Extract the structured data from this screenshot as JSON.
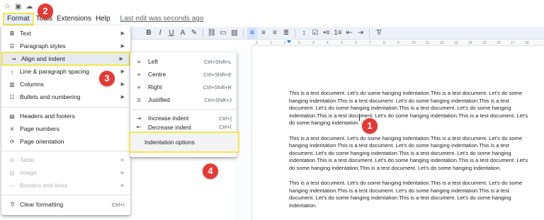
{
  "menubar": {
    "format": "Format",
    "tools": "Tools",
    "extensions": "Extensions",
    "help": "Help",
    "last_edit": "Last edit was seconds ago"
  },
  "format_menu": {
    "items": [
      {
        "label": "Text",
        "icon": "bold-icon",
        "submenu": true,
        "disabled": false
      },
      {
        "label": "Paragraph styles",
        "icon": "paragraph-styles-icon",
        "submenu": true,
        "disabled": false
      },
      {
        "label": "Align and indent",
        "icon": "align-indent-icon",
        "submenu": true,
        "disabled": false,
        "highlighted": true
      },
      {
        "label": "Line & paragraph spacing",
        "icon": "line-spacing-icon",
        "submenu": true,
        "disabled": false
      },
      {
        "label": "Columns",
        "icon": "columns-icon",
        "submenu": true,
        "disabled": false
      },
      {
        "label": "Bullets and numbering",
        "icon": "bullets-icon",
        "submenu": true,
        "disabled": false
      },
      {
        "label": "Headers and footers",
        "icon": "headers-footers-icon",
        "submenu": false,
        "disabled": false
      },
      {
        "label": "Page numbers",
        "icon": "page-numbers-icon",
        "submenu": false,
        "disabled": false
      },
      {
        "label": "Page orientation",
        "icon": "page-orientation-icon",
        "submenu": false,
        "disabled": false
      },
      {
        "label": "Table",
        "icon": "table-icon",
        "submenu": true,
        "disabled": true
      },
      {
        "label": "Image",
        "icon": "image-icon",
        "submenu": true,
        "disabled": true
      },
      {
        "label": "Borders and lines",
        "icon": "borders-lines-icon",
        "submenu": true,
        "disabled": true
      },
      {
        "label": "Clear formatting",
        "icon": "clear-formatting-icon",
        "shortcut": "Ctrl+\\",
        "disabled": false
      }
    ]
  },
  "align_submenu": {
    "items": [
      {
        "label": "Left",
        "shortcut": "Ctrl+Shift+L",
        "icon": "align-left-icon"
      },
      {
        "label": "Centre",
        "shortcut": "Ctrl+Shift+E",
        "icon": "align-center-icon"
      },
      {
        "label": "Right",
        "shortcut": "Ctrl+Shift+R",
        "icon": "align-right-icon"
      },
      {
        "label": "Justified",
        "shortcut": "Ctrl+Shift+J",
        "icon": "align-justify-icon"
      },
      {
        "label": "Increase indent",
        "shortcut": "Ctrl+]",
        "icon": "increase-indent-icon"
      },
      {
        "label": "Decrease indent",
        "shortcut": "Ctrl+[",
        "icon": "decrease-indent-icon"
      },
      {
        "label": "Indentation options",
        "highlighted": true
      }
    ]
  },
  "ruler": {
    "marks": [
      "2",
      "1",
      "1",
      "2",
      "3",
      "4",
      "5",
      "6",
      "7",
      "8",
      "9",
      "10",
      "11",
      "12",
      "13",
      "14",
      "15",
      "16",
      "17",
      "18"
    ]
  },
  "document": {
    "paragraph_1": "This is a test document. Let's do some hanging indentation.This is a test document. Let's do some hanging indentation.This is a test document. Let's do some hanging indentation.This is a test document. Let's do some hanging indentation.This is a test document. Let's do some hanging indentation.This is a test document. Let's do some hanging indentation.This is a test document. Let's do some hanging indentation.",
    "paragraph_2": "This is a test document. Let's do some hanging indentation.This is a test document. Let's do some hanging indentation.This is a test document. Let's do some hanging indentation.This is a test document. Let's do some hanging indentation.This is a test document. Let's do some hanging indentation.This is a test document. Let's do some hanging indentation.This is a test document. Let's do some hanging indentation.This is a test document. Let's do some hanging indentation.",
    "paragraph_3": "This is a test document. Let's do some hanging indentation.This is a test document. Let's do some hanging indentation.This is a test document. Let's do some hanging indentation.This is a test document. Let's do some hanging indentation.This is a test document. Let's do some hanging indentation."
  },
  "badges": [
    "1",
    "2",
    "3",
    "4"
  ],
  "colors": {
    "highlight_border": "#f2e84b",
    "badge": "#e53935",
    "accent": "#1a73e8"
  }
}
